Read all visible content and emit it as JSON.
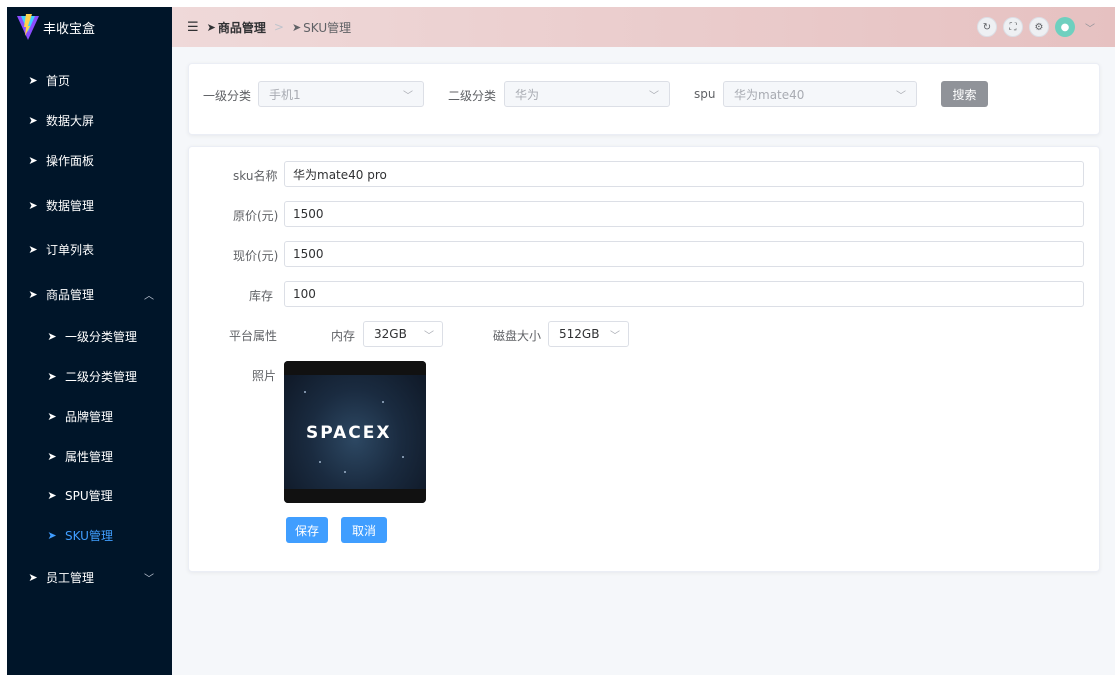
{
  "app": {
    "title": "丰收宝盒"
  },
  "sidebar": {
    "items": [
      {
        "label": "首页"
      },
      {
        "label": "数据大屏"
      },
      {
        "label": "操作面板"
      },
      {
        "label": "数据管理"
      },
      {
        "label": "订单列表"
      },
      {
        "label": "商品管理",
        "expanded": true
      },
      {
        "label": "一级分类管理"
      },
      {
        "label": "二级分类管理"
      },
      {
        "label": "品牌管理"
      },
      {
        "label": "属性管理"
      },
      {
        "label": "SPU管理"
      },
      {
        "label": "SKU管理",
        "active": true
      },
      {
        "label": "员工管理",
        "expanded": false
      }
    ],
    "active_color": "#409eff"
  },
  "header": {
    "breadcrumb": [
      "商品管理",
      "SKU管理"
    ],
    "icons": [
      "refresh-icon",
      "fullscreen-icon",
      "settings-icon",
      "avatar",
      "chevron-down-icon"
    ]
  },
  "filter": {
    "category1_label": "一级分类",
    "category1_value": "手机1",
    "category2_label": "二级分类",
    "category2_value": "华为",
    "spu_label": "spu",
    "spu_value": "华为mate40",
    "search_label": "搜索"
  },
  "form": {
    "sku_name_label": "sku名称",
    "sku_name_value": "华为mate40 pro",
    "price_label": "原价(元)",
    "price_value": "1500",
    "current_price_label": "现价(元)",
    "current_price_value": "1500",
    "stock_label": "库存",
    "stock_value": "100",
    "platform_attr_label": "平台属性",
    "attr1_label": "内存",
    "attr1_value": "32GB",
    "attr2_label": "磁盘大小",
    "attr2_value": "512GB",
    "photo_label": "照片",
    "photo_text": "SPACEX",
    "save_label": "保存",
    "cancel_label": "取消"
  }
}
